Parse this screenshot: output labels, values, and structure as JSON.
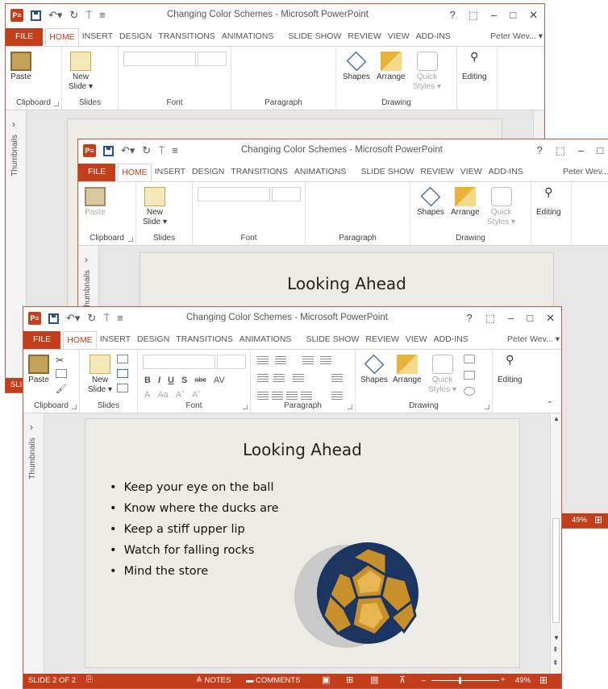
{
  "app": {
    "title": "Changing Color Schemes - Microsoft PowerPoint",
    "logo": "P≡",
    "window_controls": [
      "?",
      "⬚",
      "–",
      "□",
      "✕"
    ]
  },
  "tabs": [
    "FILE",
    "HOME",
    "INSERT",
    "DESIGN",
    "TRANSITIONS",
    "ANIMATIONS",
    "SLIDE SHOW",
    "REVIEW",
    "VIEW",
    "ADD-INS"
  ],
  "user": "Peter Wev... ▾",
  "ribbon": {
    "paste": "Paste",
    "new_slide_line1": "New",
    "new_slide_line2": "Slide ▾",
    "shapes": "Shapes",
    "arrange": "Arrange",
    "quick_styles_line1": "Quick",
    "quick_styles_line2": "Styles ▾",
    "editing": "Editing",
    "groups": {
      "clipboard": "Clipboard",
      "slides": "Slides",
      "font": "Font",
      "paragraph": "Paragraph",
      "drawing": "Drawing"
    },
    "font_format": [
      "B",
      "I",
      "U",
      "S",
      "abc",
      "AV"
    ],
    "font_size_row": [
      "A",
      "Aa",
      "Aˆ",
      "Aˇ"
    ]
  },
  "sidebar": {
    "label": "Thumbnails",
    "toggle": "›"
  },
  "slide": {
    "title": "Looking Ahead",
    "bullets": [
      "Keep your eye on the ball",
      "Know where the ducks are",
      "Keep a stiff upper lip",
      "Watch for falling rocks",
      "Mind the store"
    ]
  },
  "status": {
    "slide_indicator": "SLIDE 2 OF 2",
    "notes": "≙ NOTES",
    "comments": "▬ COMMENTS",
    "zoom": "49%",
    "back_status_left": "SLI",
    "back_zoom": "49%"
  },
  "colors": {
    "accent": "#c43e1c",
    "slide_bg": "#edebe6",
    "ball_dark": "#1c3560",
    "ball_gold": "#c8902a"
  }
}
